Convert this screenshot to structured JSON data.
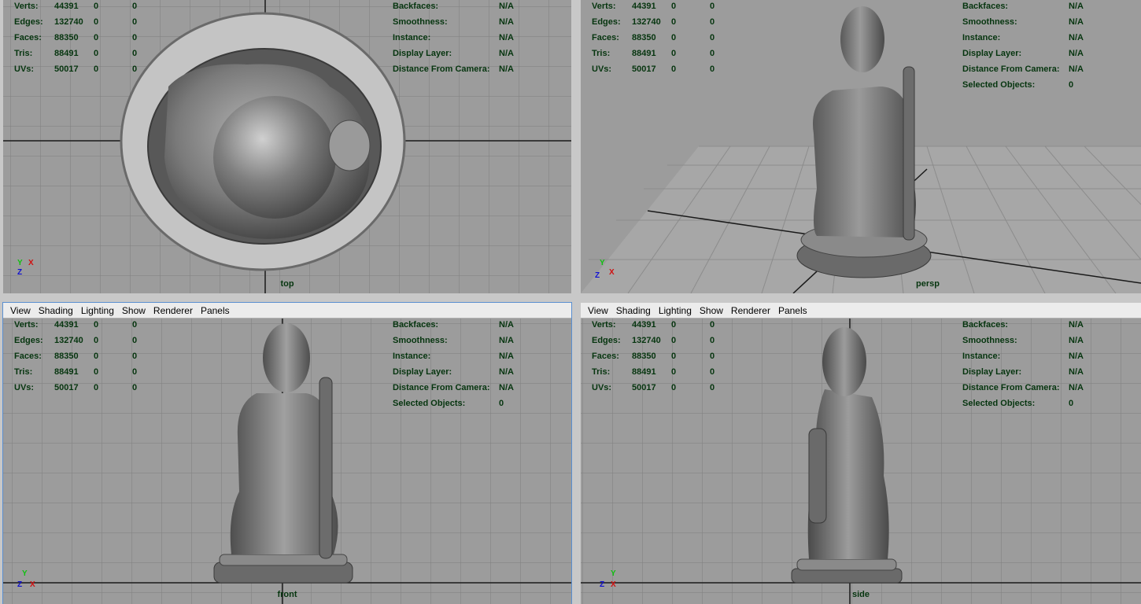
{
  "menu": [
    "View",
    "Shading",
    "Lighting",
    "Show",
    "Renderer",
    "Panels"
  ],
  "hud": {
    "left": [
      {
        "label": "Verts:",
        "v1": "44391",
        "v2": "0",
        "v3": "0"
      },
      {
        "label": "Edges:",
        "v1": "132740",
        "v2": "0",
        "v3": "0"
      },
      {
        "label": "Faces:",
        "v1": "88350",
        "v2": "0",
        "v3": "0"
      },
      {
        "label": "Tris:",
        "v1": "88491",
        "v2": "0",
        "v3": "0"
      },
      {
        "label": "UVs:",
        "v1": "50017",
        "v2": "0",
        "v3": "0"
      }
    ],
    "right": [
      {
        "label": "Backfaces:",
        "value": "N/A"
      },
      {
        "label": "Smoothness:",
        "value": "N/A"
      },
      {
        "label": "Instance:",
        "value": "N/A"
      },
      {
        "label": "Display Layer:",
        "value": "N/A"
      },
      {
        "label": "Distance From Camera:",
        "value": "N/A"
      },
      {
        "label": "Selected Objects:",
        "value": "0"
      }
    ]
  },
  "panels": {
    "top": {
      "camera": "top"
    },
    "persp": {
      "camera": "persp"
    },
    "front": {
      "camera": "front"
    },
    "side": {
      "camera": "side"
    }
  },
  "axis_labels": {
    "x": "X",
    "y": "Y",
    "z": "Z"
  },
  "colors": {
    "viewport_bg": "#9c9c9c",
    "grid": "#7e7e7e",
    "grid_axis": "#1a1a1a",
    "hud_text": "#06350f",
    "model": "#8a8a8a",
    "axis_x": "#d01010",
    "axis_y": "#10c010",
    "axis_z": "#1010d0"
  }
}
